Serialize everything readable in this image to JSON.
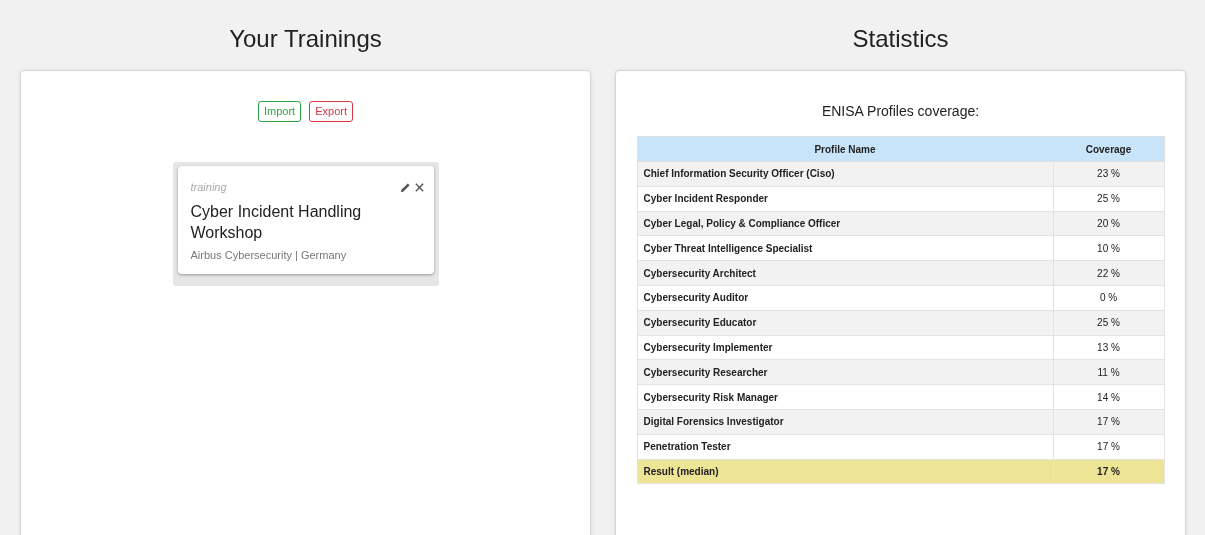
{
  "trainings_panel": {
    "title": "Your Trainings",
    "buttons": [
      {
        "label": "Import",
        "kind": "import"
      },
      {
        "label": "Export",
        "kind": "export"
      }
    ],
    "trainings": [
      {
        "type": "training",
        "title": "Cyber Incident Handling Workshop",
        "provider": "Airbus Cybersecurity | Germany"
      }
    ]
  },
  "statistics_panel": {
    "title": "Statistics",
    "table_title": "ENISA Profiles coverage:",
    "columns": [
      "Profile Name",
      "Coverage"
    ],
    "rows": [
      {
        "kind": "profile",
        "name": "Chief Information Security Officer (Ciso)",
        "coverage": "23 %"
      },
      {
        "kind": "profile",
        "name": "Cyber Incident Responder",
        "coverage": "25 %"
      },
      {
        "kind": "profile",
        "name": "Cyber Legal, Policy & Compliance Officer",
        "coverage": "20 %"
      },
      {
        "kind": "profile",
        "name": "Cyber Threat Intelligence Specialist",
        "coverage": "10 %"
      },
      {
        "kind": "profile",
        "name": "Cybersecurity Architect",
        "coverage": "22 %"
      },
      {
        "kind": "profile",
        "name": "Cybersecurity Auditor",
        "coverage": "0 %"
      },
      {
        "kind": "profile",
        "name": "Cybersecurity Educator",
        "coverage": "25 %"
      },
      {
        "kind": "profile",
        "name": "Cybersecurity Implementer",
        "coverage": "13 %"
      },
      {
        "kind": "profile",
        "name": "Cybersecurity Researcher",
        "coverage": "11 %"
      },
      {
        "kind": "profile",
        "name": "Cybersecurity Risk Manager",
        "coverage": "14 %"
      },
      {
        "kind": "profile",
        "name": "Digital Forensics Investigator",
        "coverage": "17 %"
      },
      {
        "kind": "profile",
        "name": "Penetration Tester",
        "coverage": "17 %"
      },
      {
        "kind": "result",
        "name": "Result (median)",
        "coverage": "17 %"
      }
    ]
  }
}
